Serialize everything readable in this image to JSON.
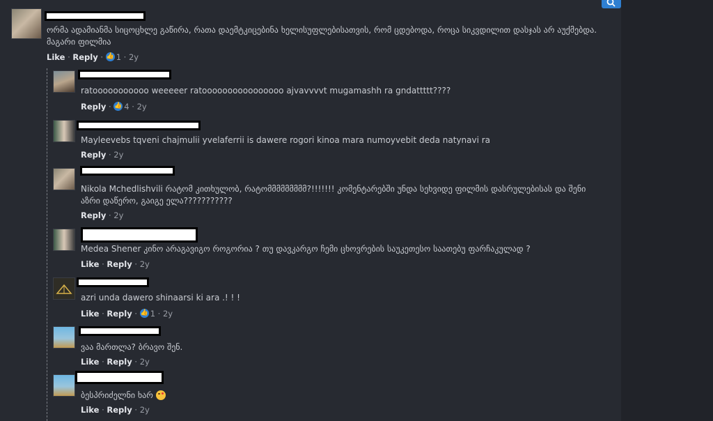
{
  "colors": {
    "background": "#272a31",
    "link": "#e4e6eb",
    "text": "#c9ccd2",
    "accent": "#2f7fd1"
  },
  "icons": {
    "search": "search-icon",
    "like": "thumbs-up-icon"
  },
  "main_comment": {
    "line1": "ორმა ადამიანმა სიცოცხლე გაწირა, რათა დაემტკიცებინა ხელისუფლებისათვის, რომ ცდებოდა, როცა სიკვდილით დასჯას არ აუქმებდა.",
    "line2": "მაგარი ფილმია",
    "like_label": "Like",
    "reply_label": "Reply",
    "reactions": "1",
    "age": "2y"
  },
  "replies": [
    {
      "text": "ratooooooooooo weeeeer ratoooooooooooooooo ajvavvvvt mugamashh ra gndattttt????",
      "reply_label": "Reply",
      "reactions": "4",
      "age": "2y"
    },
    {
      "text": "Mayleevebs tqveni chajmulii yvelaferrii is dawere rogori kinoa mara numoyvebit deda natynavi ra",
      "reply_label": "Reply",
      "age": "2y"
    },
    {
      "line1": "Nikola Mchedlishvili რატომ კითხულობ, რატომმმმმმმმმ?!!!!!!! კომენტარებში უნდა სეხვიდე ფილმის დასრულებისას და შენი",
      "line2": "აზრი დაწერო, გაიგე ელა???????????",
      "reply_label": "Reply",
      "age": "2y"
    },
    {
      "text": "Medea Shener კინო არაგავიგო როგორია ? თუ დავკარგო ჩემი ცხოვრების საუკეთესო საათებუ ფარჩაკულად ?",
      "like_label": "Like",
      "reply_label": "Reply",
      "age": "2y"
    },
    {
      "text": "azri unda dawero shinaarsi ki ara .! ! !",
      "like_label": "Like",
      "reply_label": "Reply",
      "reactions": "1",
      "age": "2y"
    },
    {
      "text": "ვაა მართლა? ბრავო შენ.",
      "like_label": "Like",
      "reply_label": "Reply",
      "age": "2y"
    },
    {
      "text": "ბესპრიძელნი ხარ",
      "like_label": "Like",
      "reply_label": "Reply",
      "age": "2y"
    }
  ]
}
